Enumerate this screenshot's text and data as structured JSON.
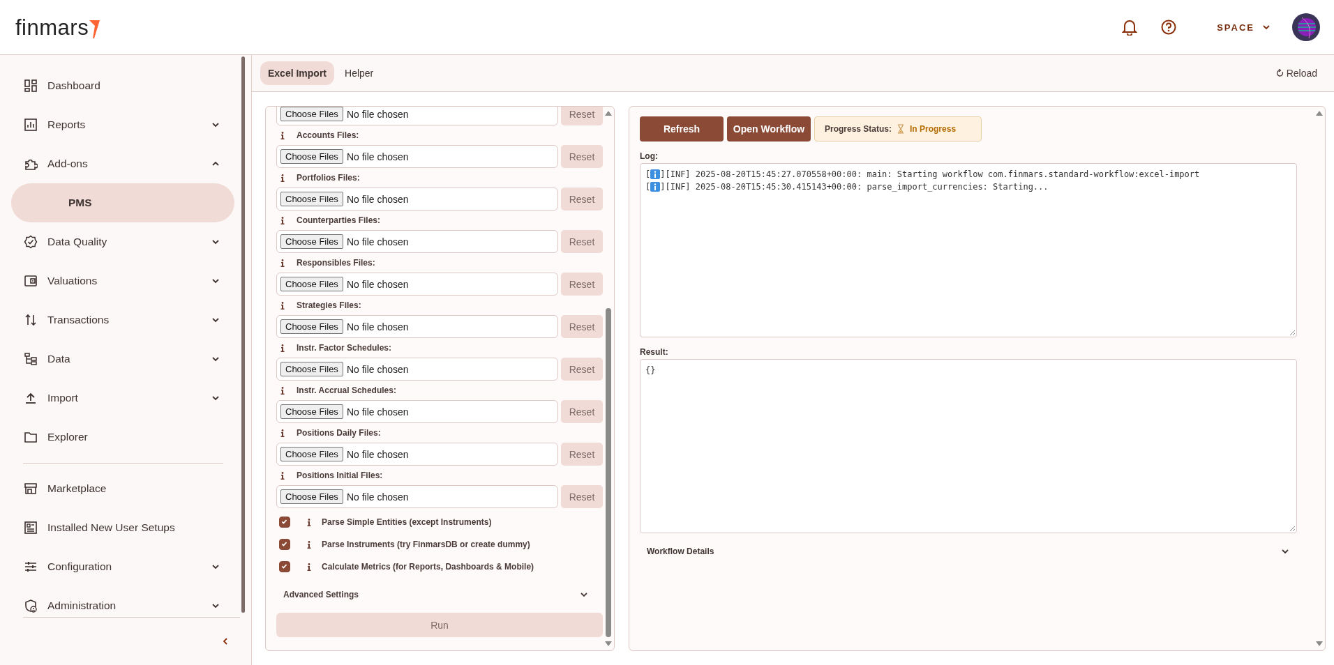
{
  "header": {
    "logo": "finmars",
    "workspace": "SPACE"
  },
  "sidebar": {
    "sections": [
      {
        "items": [
          {
            "label": "Dashboard"
          },
          {
            "label": "Reports",
            "expanded": false
          },
          {
            "label": "Add-ons",
            "expanded": true,
            "children": [
              {
                "label": "PMS",
                "selected": true
              }
            ]
          },
          {
            "label": "Data Quality",
            "expanded": false
          },
          {
            "label": "Valuations",
            "expanded": false
          },
          {
            "label": "Transactions",
            "expanded": false
          },
          {
            "label": "Data",
            "expanded": false
          },
          {
            "label": "Import",
            "expanded": false
          },
          {
            "label": "Explorer"
          }
        ]
      },
      {
        "items": [
          {
            "label": "Marketplace"
          },
          {
            "label": "Installed New User Setups"
          },
          {
            "label": "Configuration",
            "expanded": false
          },
          {
            "label": "Administration",
            "expanded": false
          }
        ]
      }
    ]
  },
  "tabs": [
    {
      "label": "Excel Import",
      "selected": true
    },
    {
      "label": "Helper",
      "selected": false
    }
  ],
  "reload": "Reload",
  "import_form": {
    "file_fields": [
      {
        "button": "Choose Files",
        "value": "No file chosen",
        "reset": "Reset"
      },
      {
        "label": "Accounts Files:",
        "button": "Choose Files",
        "value": "No file chosen",
        "reset": "Reset"
      },
      {
        "label": "Portfolios Files:",
        "button": "Choose Files",
        "value": "No file chosen",
        "reset": "Reset"
      },
      {
        "label": "Counterparties Files:",
        "button": "Choose Files",
        "value": "No file chosen",
        "reset": "Reset"
      },
      {
        "label": "Responsibles Files:",
        "button": "Choose Files",
        "value": "No file chosen",
        "reset": "Reset"
      },
      {
        "label": "Strategies Files:",
        "button": "Choose Files",
        "value": "No file chosen",
        "reset": "Reset"
      },
      {
        "label": "Instr. Factor Schedules:",
        "button": "Choose Files",
        "value": "No file chosen",
        "reset": "Reset"
      },
      {
        "label": "Instr. Accrual Schedules:",
        "button": "Choose Files",
        "value": "No file chosen",
        "reset": "Reset"
      },
      {
        "label": "Positions Daily Files:",
        "button": "Choose Files",
        "value": "No file chosen",
        "reset": "Reset"
      },
      {
        "label": "Positions Initial Files:",
        "button": "Choose Files",
        "value": "No file chosen",
        "reset": "Reset"
      }
    ],
    "options": [
      {
        "label": "Parse Simple Entities (except Instruments)",
        "checked": true
      },
      {
        "label": "Parse Instruments (try FinmarsDB or create dummy)",
        "checked": true
      },
      {
        "label": "Calculate Metrics (for Reports, Dashboards & Mobile)",
        "checked": true
      }
    ],
    "advanced_settings": {
      "label": "Advanced Settings",
      "expanded": false
    },
    "run": "Run"
  },
  "workflow": {
    "buttons": [
      "Refresh",
      "Open Workflow"
    ],
    "progress": {
      "label": "Progress Status:",
      "value": "In Progress"
    },
    "log": {
      "label": "Log:",
      "lines": [
        {
          "kind": "info",
          "open": "[",
          "close": "]",
          "message": "[INF] 2025-08-20T15:45:27.070558+00:00: main: Starting workflow com.finmars.standard-workflow:excel-import"
        },
        {
          "kind": "info",
          "open": "[",
          "close": "]",
          "message": "[INF] 2025-08-20T15:45:30.415143+00:00: parse_import_currencies: Starting..."
        }
      ]
    },
    "result": {
      "label": "Result:",
      "value": "{}"
    },
    "details": {
      "label": "Workflow Details",
      "expanded": false
    }
  }
}
